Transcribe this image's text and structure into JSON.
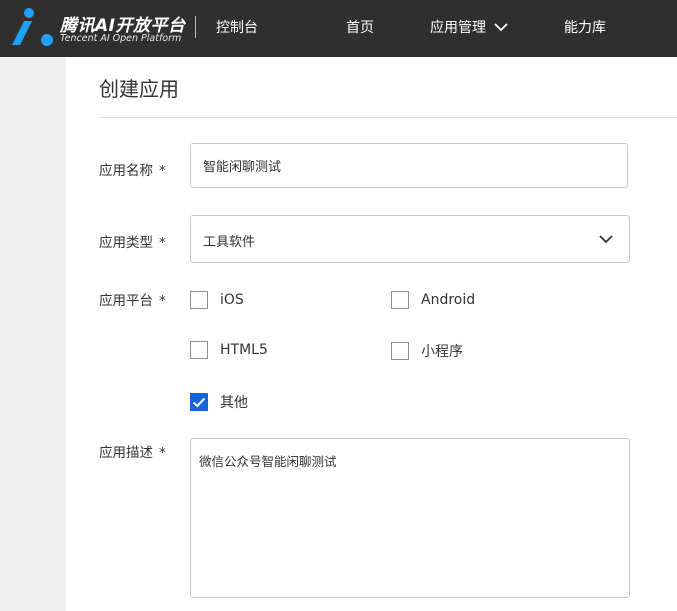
{
  "header": {
    "logo_title": "腾讯AI开放平台",
    "logo_subtitle": "Tencent AI Open Platform",
    "console": "控制台",
    "nav": {
      "home": "首页",
      "app_manage": "应用管理",
      "capability_lib": "能力库"
    }
  },
  "page": {
    "title": "创建应用"
  },
  "form": {
    "required_mark": "*",
    "name": {
      "label": "应用名称",
      "value": "智能闲聊测试"
    },
    "type": {
      "label": "应用类型",
      "value": "工具软件"
    },
    "platform": {
      "label": "应用平台",
      "options": [
        {
          "label": "iOS",
          "checked": false
        },
        {
          "label": "Android",
          "checked": false
        },
        {
          "label": "HTML5",
          "checked": false
        },
        {
          "label": "小程序",
          "checked": false
        },
        {
          "label": "其他",
          "checked": true
        }
      ]
    },
    "description": {
      "label": "应用描述",
      "value": "微信公众号智能闲聊测试"
    }
  },
  "colors": {
    "topbar": "#2f2f2f",
    "accent": "#1665d8",
    "logo_blue": "#1ea0ff"
  }
}
